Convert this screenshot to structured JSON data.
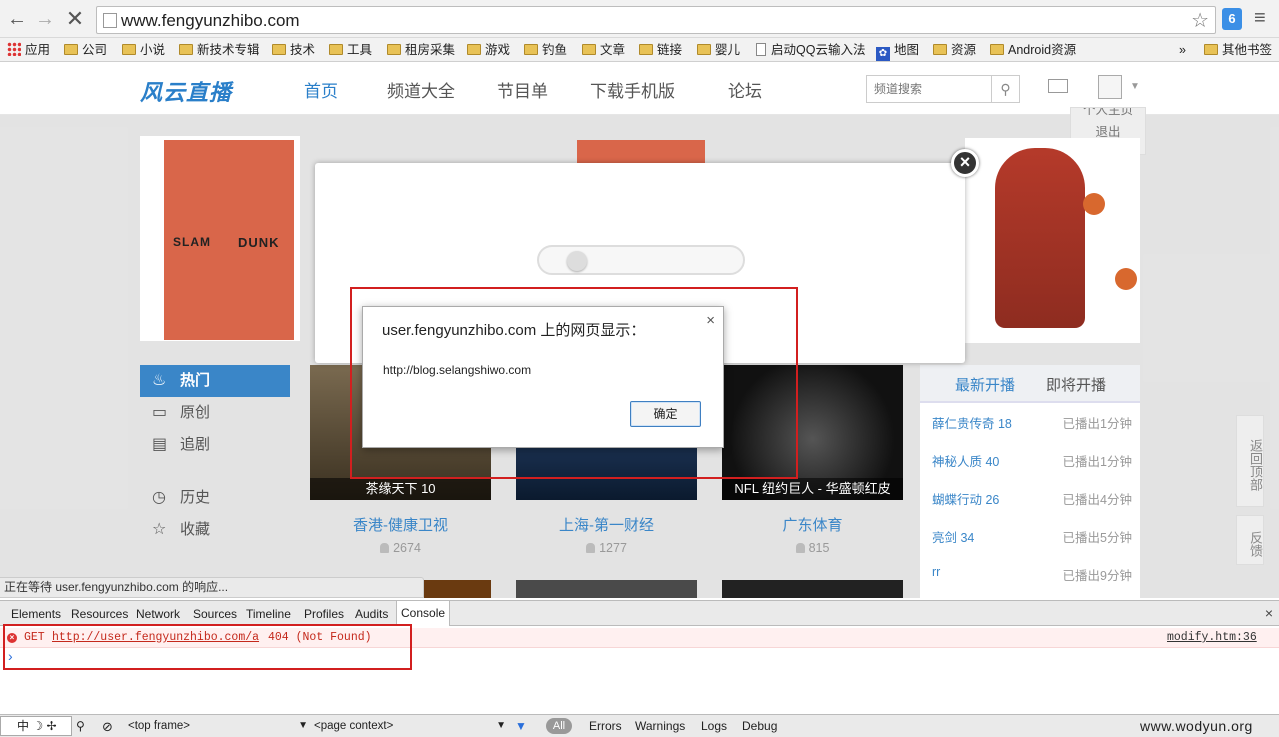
{
  "browser": {
    "url": "www.fengyunzhibo.com",
    "bookmarks": [
      "应用",
      "公司",
      "小说",
      "新技术专辑",
      "技术",
      "工具",
      "租房采集",
      "游戏",
      "钓鱼",
      "文章",
      "链接",
      "婴儿",
      "启动QQ云输入法",
      "地图",
      "资源",
      "Android资源",
      "»",
      "其他书签"
    ]
  },
  "site": {
    "logo": "风云直播",
    "nav": [
      "首页",
      "频道大全",
      "节目单",
      "下载手机版",
      "论坛"
    ],
    "search_placeholder": "频道搜索",
    "user_menu": [
      "个人主页",
      "退出"
    ],
    "banner": {
      "slam": "SLAM",
      "dunk": "DUNK"
    },
    "left_menu": [
      "热门",
      "原创",
      "追剧",
      "历史",
      "收藏"
    ],
    "videos": [
      {
        "caption": "茶缘天下 10",
        "title": "香港-健康卫视",
        "count": "2674"
      },
      {
        "caption": "",
        "title": "上海-第一财经",
        "count": "1277"
      },
      {
        "caption": "NFL 纽约巨人 - 华盛顿红皮",
        "title": "广东体育",
        "count": "815"
      }
    ],
    "right_tabs": [
      "最新开播",
      "即将开播"
    ],
    "right_list": [
      {
        "name": "薛仁贵传奇 18",
        "time": "已播出1分钟"
      },
      {
        "name": "神秘人质 40",
        "time": "已播出1分钟"
      },
      {
        "name": "蝴蝶行动 26",
        "time": "已播出4分钟"
      },
      {
        "name": "亮剑 34",
        "time": "已播出5分钟"
      },
      {
        "name": "rr",
        "time": "已播出9分钟"
      }
    ],
    "side_buttons": [
      "返回顶部",
      "反馈"
    ]
  },
  "alert": {
    "title": "user.fengyunzhibo.com 上的网页显示：",
    "message": "http://blog.selangshiwo.com",
    "ok": "确定"
  },
  "status_text": "正在等待 user.fengyunzhibo.com 的响应...",
  "devtools": {
    "tabs": [
      "Elements",
      "Resources",
      "Network",
      "Sources",
      "Timeline",
      "Profiles",
      "Audits",
      "Console"
    ],
    "error": {
      "method": "GET",
      "url": "http://user.fengyunzhibo.com/a",
      "status": "404 (Not Found)",
      "source": "modify.htm:36"
    },
    "prompt": "›",
    "frame": "<top frame>",
    "context": "<page context>",
    "filters": [
      "All",
      "Errors",
      "Warnings",
      "Logs",
      "Debug"
    ]
  },
  "ime": "中",
  "watermark": "www.wodyun.org"
}
